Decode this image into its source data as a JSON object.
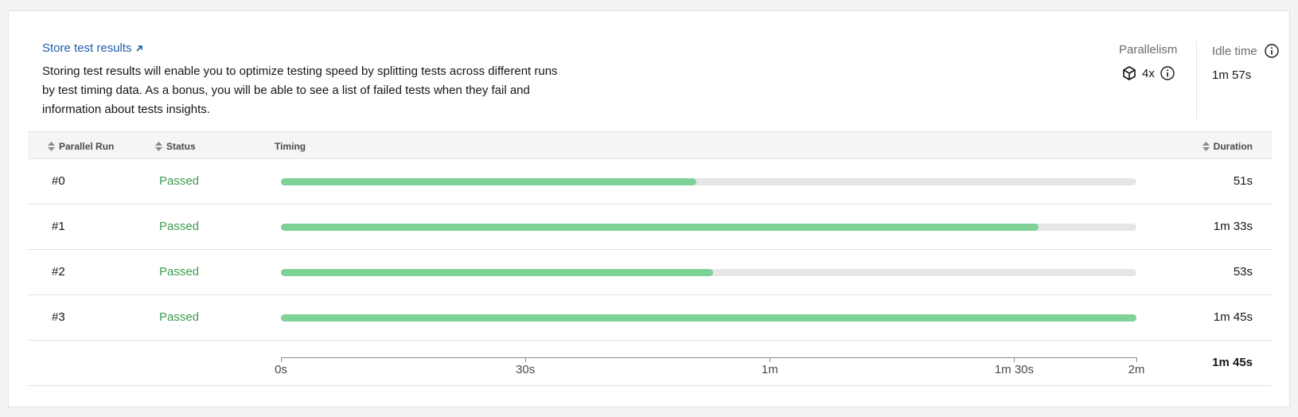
{
  "store_link": {
    "label": "Store test results"
  },
  "description": "Storing test results will enable you to optimize testing speed by splitting tests across different runs by test timing data. As a bonus, you will be able to see a list of failed tests when they fail and information about tests insights.",
  "stats": {
    "parallelism": {
      "label": "Parallelism",
      "value": "4x",
      "icon": "box-icon"
    },
    "idle_time": {
      "label": "Idle time",
      "value": "1m 57s"
    }
  },
  "table": {
    "headers": {
      "run": "Parallel Run",
      "status": "Status",
      "timing": "Timing",
      "duration": "Duration"
    },
    "rows": [
      {
        "run": "#0",
        "status": "Passed",
        "duration": "51s",
        "seconds": 51
      },
      {
        "run": "#1",
        "status": "Passed",
        "duration": "1m 33s",
        "seconds": 93
      },
      {
        "run": "#2",
        "status": "Passed",
        "duration": "53s",
        "seconds": 53
      },
      {
        "run": "#3",
        "status": "Passed",
        "duration": "1m 45s",
        "seconds": 105
      }
    ],
    "axis": {
      "max_seconds": 105,
      "ticks": [
        {
          "label": "0s",
          "seconds": 0
        },
        {
          "label": "30s",
          "seconds": 30
        },
        {
          "label": "1m",
          "seconds": 60
        },
        {
          "label": "1m 30s",
          "seconds": 90
        },
        {
          "label": "2m",
          "seconds": 105
        }
      ]
    },
    "total_duration": "1m 45s"
  },
  "colors": {
    "link": "#1c5fa8",
    "passed": "#3d9a50",
    "bar_fill": "#7ed197",
    "bar_track": "#e6e6e6"
  }
}
